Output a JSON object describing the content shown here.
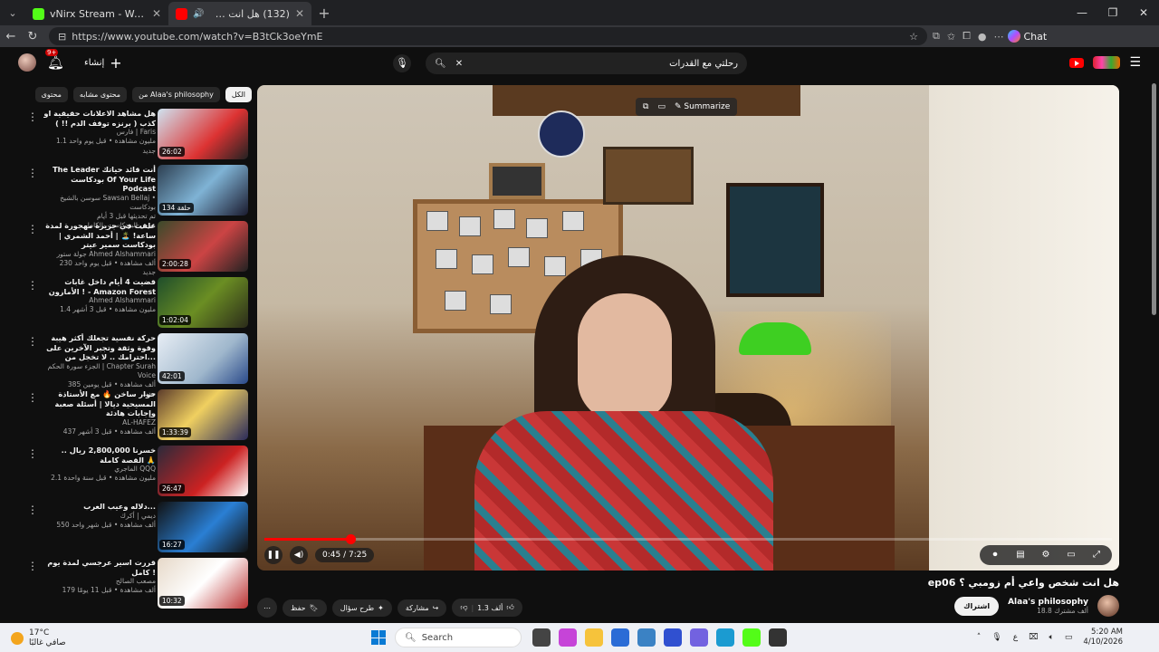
{
  "browser": {
    "tabs": [
      {
        "title": "vNirx Stream - Watch Live on Kick",
        "favicon_color": "#53fc18",
        "active": false
      },
      {
        "title": "(132) هل انت شخص واعي أم ز",
        "favicon_color": "#ff0000",
        "active": true
      }
    ],
    "url": "https://www.youtube.com/watch?v=B3tCk3oeYmE",
    "chat_label": "Chat"
  },
  "yt_header": {
    "create_label": "إنشاء",
    "notification_count": "9+",
    "search_query": "رحلتي مع القدرات"
  },
  "chips": [
    {
      "label": "الكل",
      "active": true
    },
    {
      "label": "من Alaa's philosophy",
      "active": false
    },
    {
      "label": "محتوى مشابه",
      "active": false
    },
    {
      "label": "محتوى",
      "active": false
    }
  ],
  "recommendations": [
    {
      "title": "هل مشاهد الاعلانات حقيقية او كذب ( برنزه توقف الدم !! )",
      "channel": "فارس | Faris",
      "meta": "1.1 مليون مشاهدة • قبل يوم واحد",
      "badge": "جديد",
      "duration": "26:02",
      "thumb": "linear-gradient(135deg,#cfe3f0,#d33 60%,#222)"
    },
    {
      "title": "The Leader أنت قائد حياتك بودكاست Of Your Life Podcast",
      "channel": "سوسن بالشيخ Sawsan Bellaj • بودكاست",
      "meta": "تم تحديثها قبل 3 أيام",
      "badge": "عرض البودكاست بالكامل",
      "duration": "134 حلقة",
      "thumb": "linear-gradient(135deg,#2c3e50,#7fb3d5,#1a1a2e)"
    },
    {
      "title": "علقت في جزيرة مهجورة لمدة ساعة! 🏝️ | أحمد الشمري | بودكاست سمير عيتر",
      "channel": "جولة ستور Ahmed Alshammari",
      "meta": "230 ألف مشاهدة • قبل يوم واحد",
      "badge": "جديد",
      "duration": "2:00:28",
      "thumb": "linear-gradient(135deg,#3a4a2a,#c44 55%,#222)"
    },
    {
      "title": "قضيت 4 أيام داخل غابات الأمازون ! - Amazon Forest",
      "channel": "Ahmed Alshammari",
      "meta": "1.4 مليون مشاهدة • قبل 3 أشهر",
      "badge": "",
      "duration": "1:02:04",
      "thumb": "linear-gradient(135deg,#1e4d2b,#6b8e23,#2b2b1a)"
    },
    {
      "title": "حركة نفسية تجعلك أكثر هيبة وقوة وثقة وتجبر الآخرين على احترامك .. لا تخجل من...",
      "channel": "الجزء سورة الحكم | Chapter Surah Voice",
      "meta": "385 ألف مشاهدة • قبل يومين",
      "badge": "جديد",
      "duration": "42:01",
      "thumb": "linear-gradient(135deg,#e8eef5,#9fb7cc 60%,#2a4a8a)"
    },
    {
      "title": "حوار ساخن 🔥 مع الأستاذة المسيحية ديالا | أسئلة صعبة وإجابات هادئة",
      "channel": "AL-HAFEZ",
      "meta": "437 ألف مشاهدة • قبل 3 أشهر",
      "badge": "",
      "duration": "1:33:39",
      "thumb": "linear-gradient(135deg,#5a3a2a,#f0d060 45%,#2a2a5a)"
    },
    {
      "title": "خسرنا 2,800,000 ريال .. القصة كاملة 🙏",
      "channel": "الماجري QQQ",
      "meta": "2.1 مليون مشاهدة • قبل سنة واحدة",
      "badge": "",
      "duration": "26:47",
      "thumb": "linear-gradient(135deg,#2a2a3a,#c22 60%,#fff)"
    },
    {
      "title": "دلاله وعيب العرب...",
      "channel": "ديمي | أكرك",
      "meta": "550 ألف مشاهدة • قبل شهر واحد",
      "badge": "",
      "duration": "16:27",
      "thumb": "linear-gradient(135deg,#111,#2a7fd4 55%,#111)"
    },
    {
      "title": "قررت اسير عرجسي لمدة يوم كامل !",
      "channel": "مصعب الصالح",
      "meta": "179 ألف مشاهدة • قبل 11 يومًا",
      "badge": "",
      "duration": "10:32",
      "thumb": "linear-gradient(135deg,#e6d8c8,#fff 50%,#b33)"
    }
  ],
  "player": {
    "summarize_label": "Summarize",
    "time_display": "0:45 / 7:25",
    "progress_fraction": 0.101
  },
  "video": {
    "title": "هل انت شخص واعي أم زومبي ؟ ep06",
    "channel_name": "Alaa's philosophy",
    "subscribers": "18.8 ألف مشترك",
    "subscribe_label": "اشتراك",
    "like_count": "1.3 ألف",
    "share_label": "مشاركة",
    "ask_label": "طرح سؤال",
    "save_label": "حفظ"
  },
  "taskbar": {
    "temperature": "17°C",
    "weather_text": "صافي غالبًا",
    "search_label": "Search",
    "time": "5:20 AM",
    "date": "4/10/2026",
    "lang": "ع"
  }
}
